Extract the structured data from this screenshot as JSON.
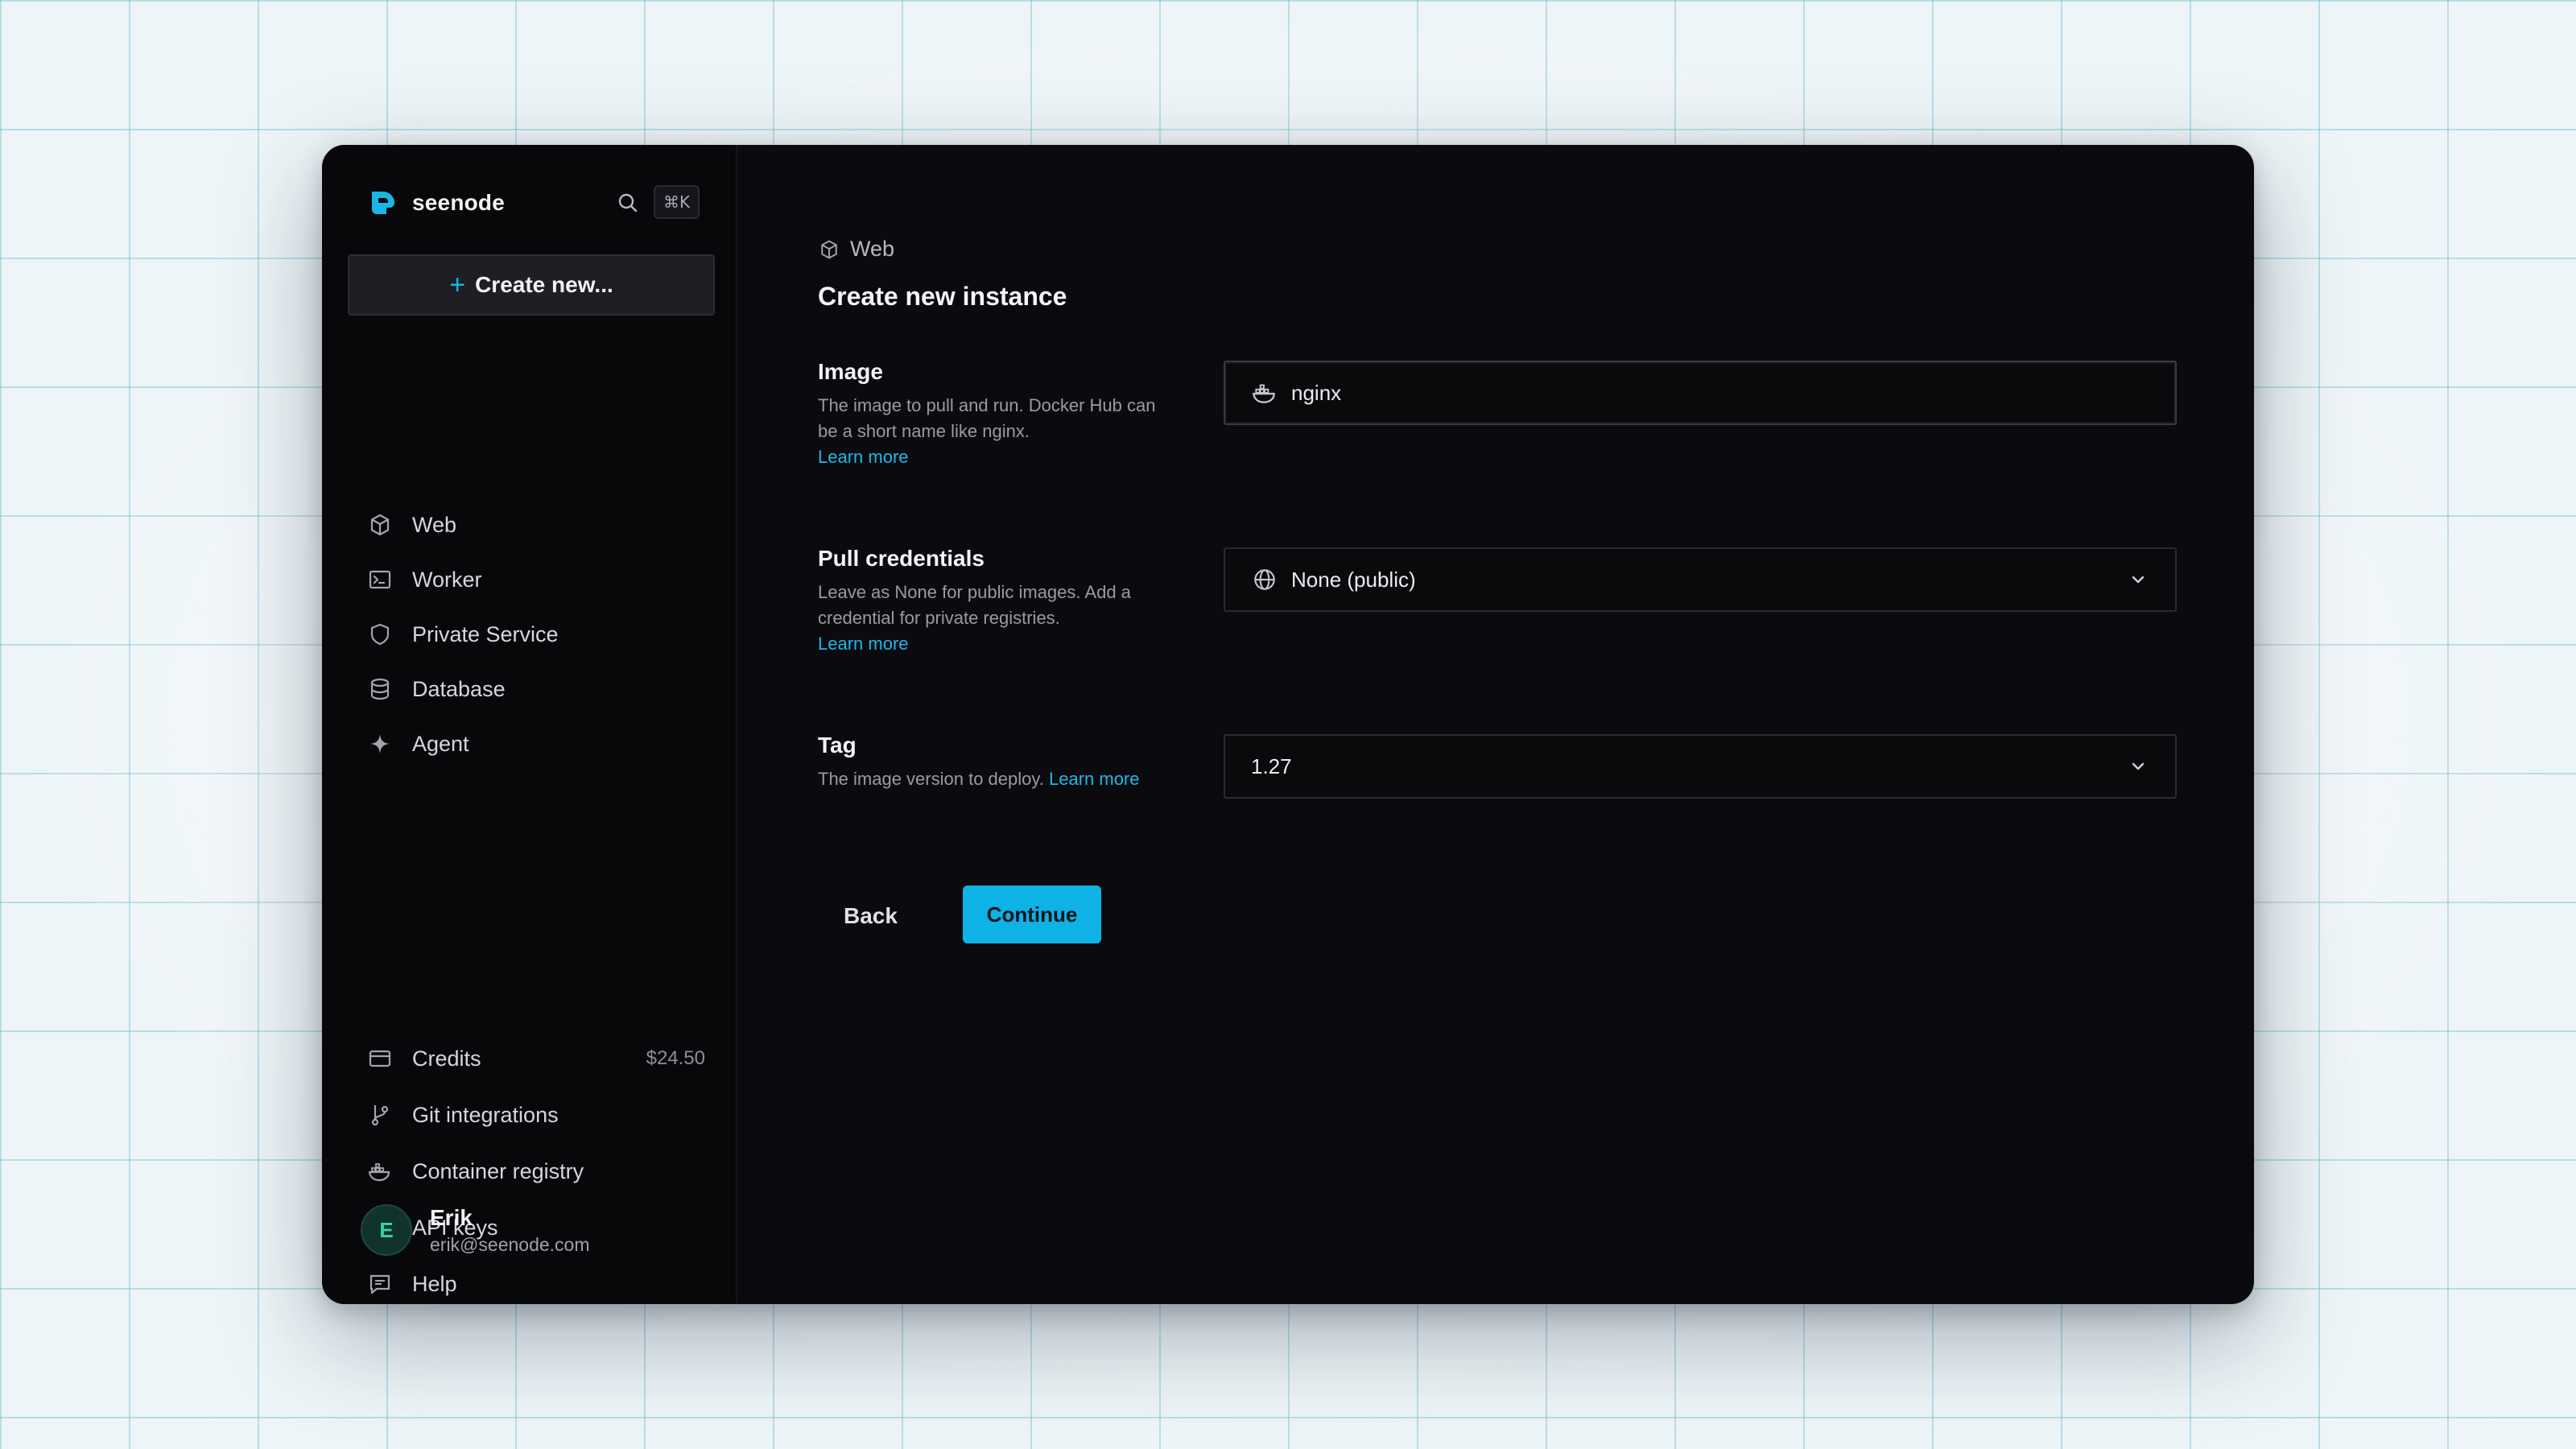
{
  "app": {
    "brand": "seenode",
    "shortcut": "⌘K",
    "accent": "#0eb2e4"
  },
  "sidebar": {
    "create_label": "Create new...",
    "items": [
      {
        "label": "Web",
        "icon": "hexagon-icon"
      },
      {
        "label": "Worker",
        "icon": "terminal-icon"
      },
      {
        "label": "Private Service",
        "icon": "shield-icon"
      },
      {
        "label": "Database",
        "icon": "database-icon"
      },
      {
        "label": "Agent",
        "icon": "sparkle-icon"
      }
    ],
    "bottom_items": [
      {
        "label": "Credits",
        "icon": "credit-card-icon",
        "value": "$24.50"
      },
      {
        "label": "Git integrations",
        "icon": "git-branch-icon"
      },
      {
        "label": "Container registry",
        "icon": "docker-icon"
      },
      {
        "label": "API keys",
        "icon": "key-icon"
      },
      {
        "label": "Help",
        "icon": "message-icon"
      }
    ],
    "user": {
      "initial": "E",
      "name": "Erik",
      "email": "erik@seenode.com"
    }
  },
  "main": {
    "breadcrumb": "Web",
    "title": "Create new instance",
    "fields": {
      "image": {
        "label": "Image",
        "help": "The image to pull and run. Docker Hub can be a short name like nginx.",
        "link": "Learn more",
        "value": "nginx"
      },
      "credentials": {
        "label": "Pull credentials",
        "help": "Leave as None for public images. Add a credential for private registries.",
        "link": "Learn more",
        "value": "None (public)"
      },
      "tag": {
        "label": "Tag",
        "help": "The image version to deploy.",
        "link": "Learn more",
        "value": "1.27"
      }
    },
    "back_label": "Back",
    "continue_label": "Continue"
  }
}
